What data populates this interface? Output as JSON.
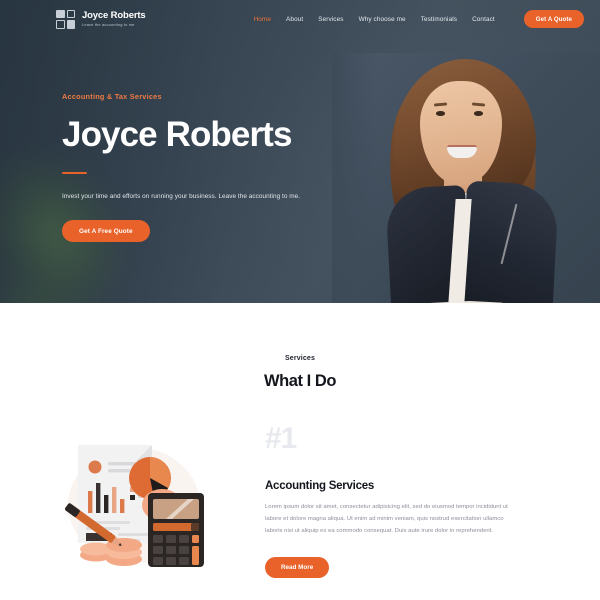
{
  "colors": {
    "accent": "#e8622a",
    "accent_light": "#ee7a42",
    "hero_bg": "#3d4b59",
    "dark_text": "#13161d",
    "muted_text": "#8b8f99",
    "num_gray": "#e7e9ee"
  },
  "navbar": {
    "brand_name": "Joyce Roberts",
    "brand_tagline": "Leave the accounting to me",
    "links": [
      {
        "label": "Home",
        "active": true
      },
      {
        "label": "About",
        "active": false
      },
      {
        "label": "Services",
        "active": false
      },
      {
        "label": "Why choose me",
        "active": false
      },
      {
        "label": "Testimonials",
        "active": false
      },
      {
        "label": "Contact",
        "active": false
      }
    ],
    "cta_label": "Get A Quote"
  },
  "hero": {
    "eyebrow": "Accounting & Tax Services",
    "title": "Joyce Roberts",
    "subtitle": "Invest your time and efforts on running your business. Leave the accounting to me.",
    "cta_label": "Get A Free Quote",
    "photo_alt": "portrait-of-joyce-roberts"
  },
  "services": {
    "eyebrow": "Services",
    "title": "What I Do",
    "items": [
      {
        "number": "#1",
        "title": "Accounting Services",
        "text": "Lorem ipsum dolor sit amet, consectetur adipisicing elit, sed do eiusmod tempor incididunt ut labore et dolore magna aliqua. Ut enim ad minim veniam, quis nostrud exercitation ullamco laboris nisi ut aliquip ex ea commodo consequat. Duis aute irure dolor in reprehenderit.",
        "button_label": "Read More",
        "illustration": "accounting-report-calculator-illustration"
      }
    ]
  }
}
